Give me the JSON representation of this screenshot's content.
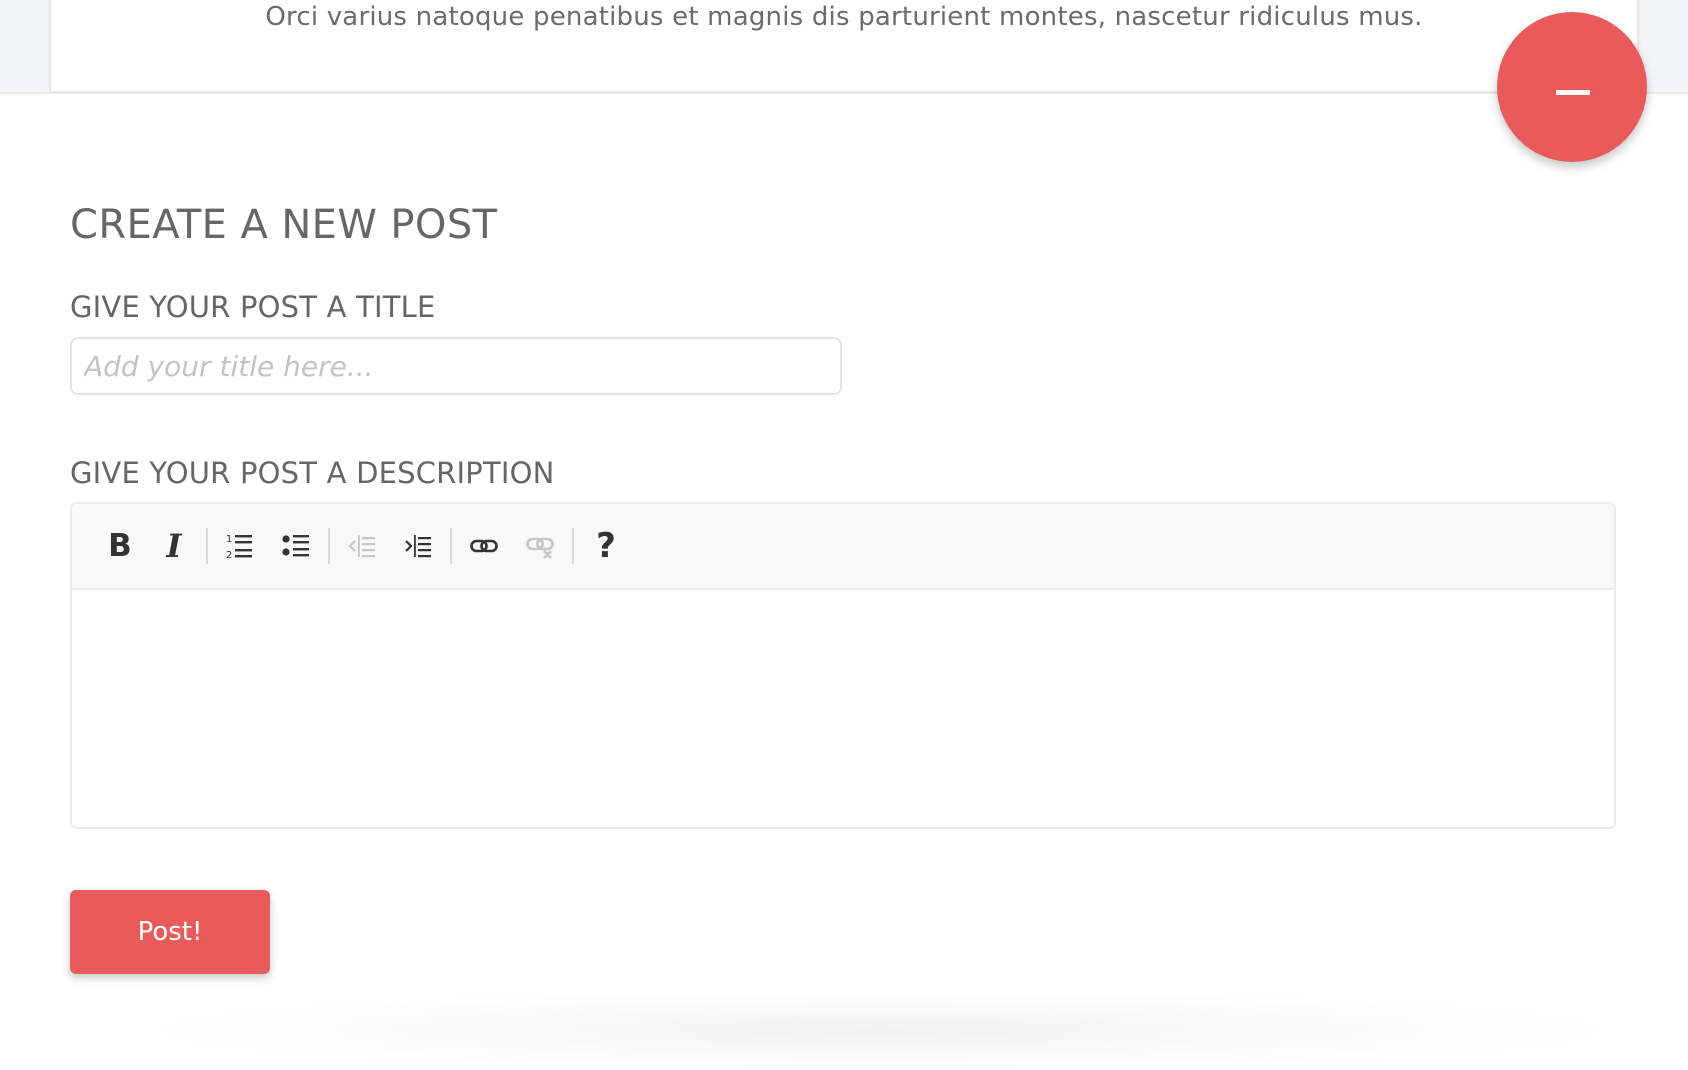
{
  "previous_post": {
    "excerpt": "Orci varius natoque penatibus et magnis dis parturient montes, nascetur ridiculus mus."
  },
  "fab": {
    "icon": "minus-icon",
    "color": "#e95b5b"
  },
  "form": {
    "heading": "CREATE A NEW POST",
    "title_label": "GIVE YOUR POST A TITLE",
    "title_value": "",
    "title_placeholder": "Add your title here...",
    "description_label": "GIVE YOUR POST A DESCRIPTION",
    "description_value": "",
    "submit_label": "Post!"
  },
  "toolbar": {
    "buttons": [
      {
        "name": "bold",
        "glyph": "B",
        "icon": "bold-icon",
        "enabled": true
      },
      {
        "name": "italic",
        "glyph": "I",
        "icon": "italic-icon",
        "enabled": true
      },
      {
        "name": "numbered-list",
        "icon": "numbered-list-icon",
        "enabled": true
      },
      {
        "name": "bulleted-list",
        "icon": "bulleted-list-icon",
        "enabled": true
      },
      {
        "name": "outdent",
        "icon": "outdent-icon",
        "enabled": false
      },
      {
        "name": "indent",
        "icon": "indent-icon",
        "enabled": true
      },
      {
        "name": "link",
        "icon": "link-icon",
        "enabled": true
      },
      {
        "name": "unlink",
        "icon": "unlink-icon",
        "enabled": false
      },
      {
        "name": "help",
        "glyph": "?",
        "icon": "help-icon",
        "enabled": true
      }
    ]
  },
  "colors": {
    "accent": "#e95b5b",
    "text": "#666666",
    "placeholder": "#c3c3c3",
    "toolbar_background": "#f8f8f8"
  }
}
